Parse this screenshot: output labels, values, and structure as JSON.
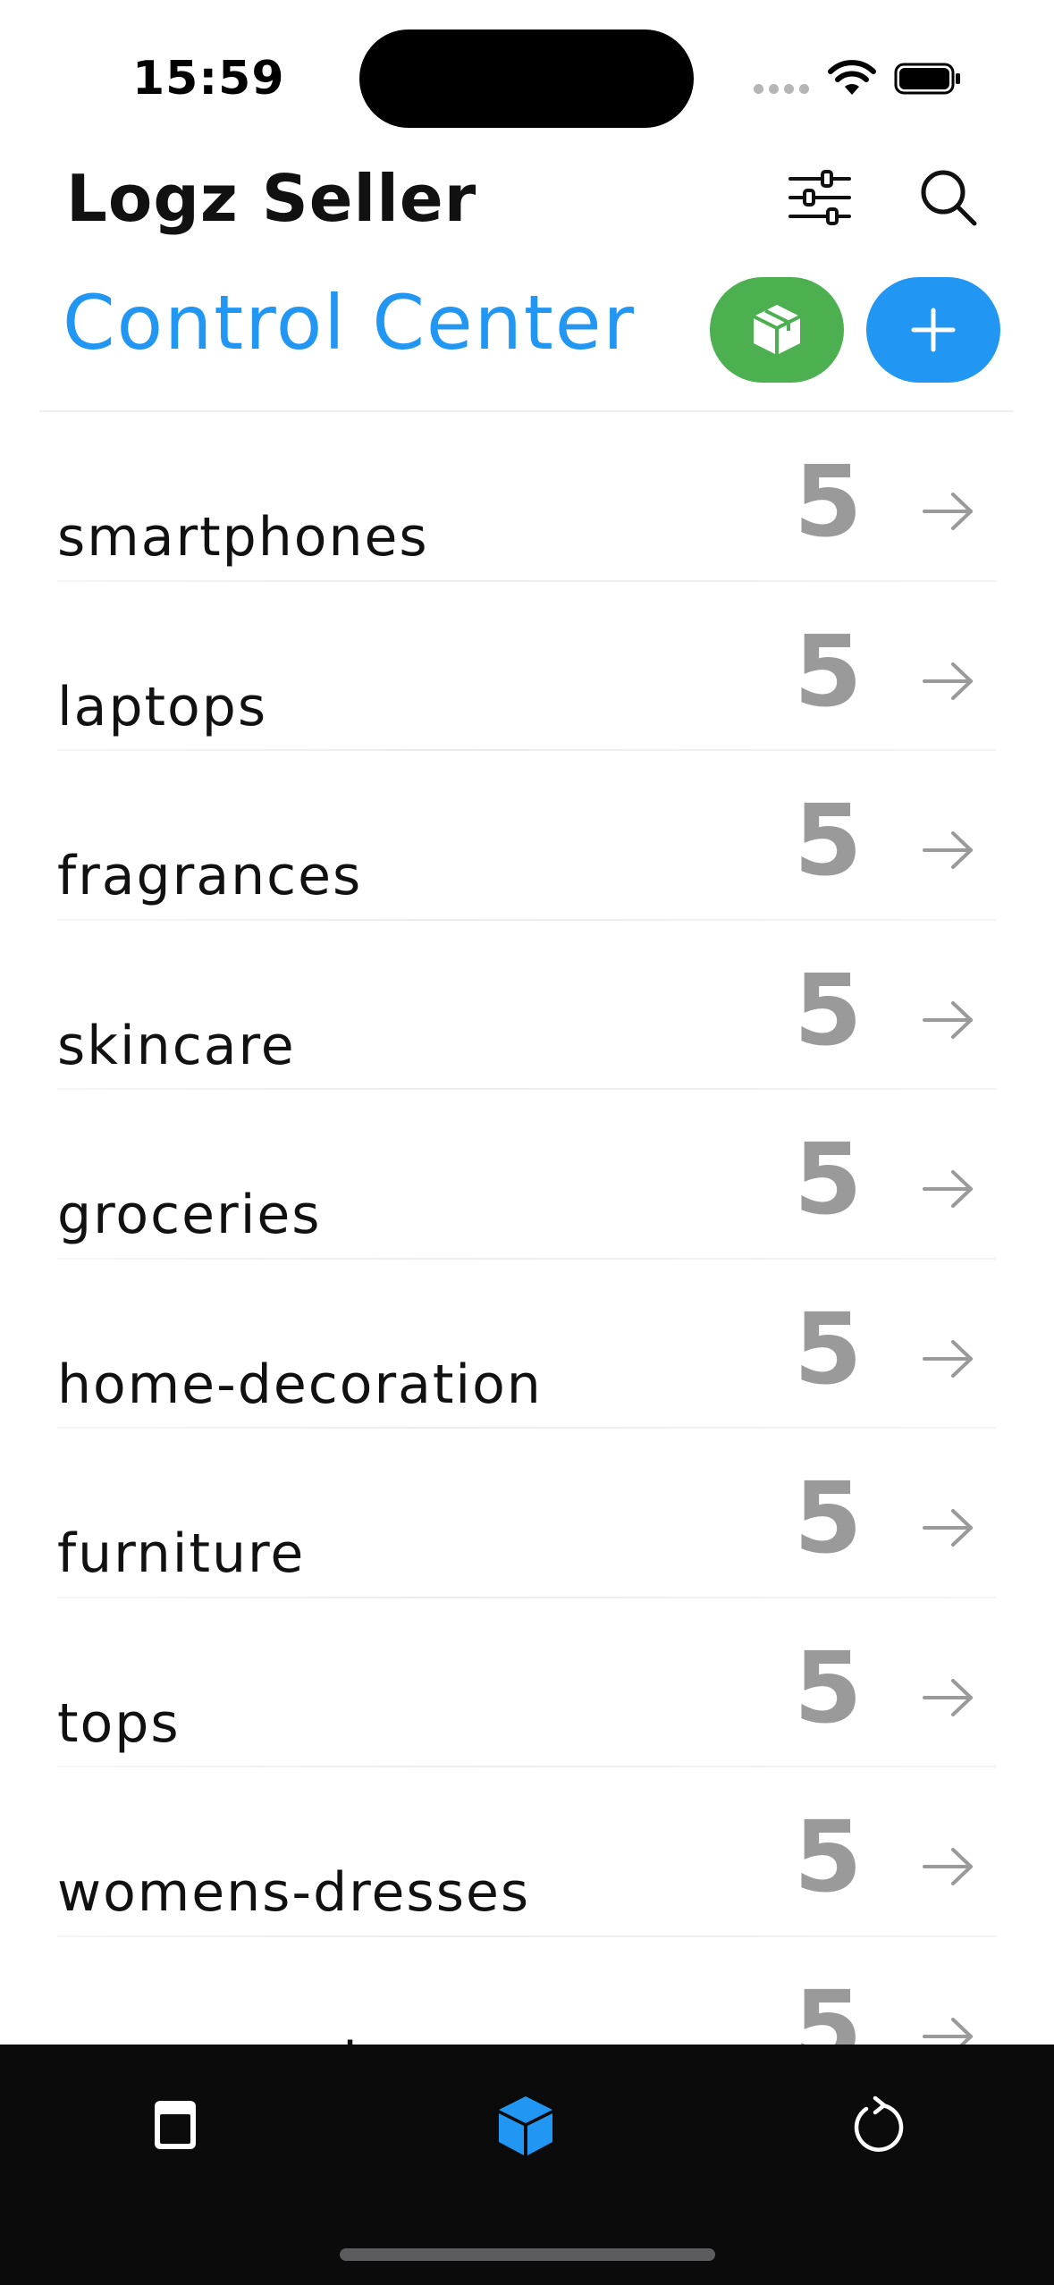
{
  "status_bar": {
    "time": "15:59"
  },
  "header": {
    "app_title": "Logz Seller",
    "filter_icon": "sliders-icon",
    "search_icon": "search-icon"
  },
  "section": {
    "title": "Control Center",
    "primary_action_icon": "package-icon",
    "add_action_icon": "plus-icon"
  },
  "categories": [
    {
      "name": "smartphones",
      "count": "5"
    },
    {
      "name": "laptops",
      "count": "5"
    },
    {
      "name": "fragrances",
      "count": "5"
    },
    {
      "name": "skincare",
      "count": "5"
    },
    {
      "name": "groceries",
      "count": "5"
    },
    {
      "name": "home-decoration",
      "count": "5"
    },
    {
      "name": "furniture",
      "count": "5"
    },
    {
      "name": "tops",
      "count": "5"
    },
    {
      "name": "womens-dresses",
      "count": "5"
    },
    {
      "name": "womens-shoes",
      "count": "5"
    }
  ],
  "tab_bar": {
    "tabs": [
      {
        "icon": "book-icon",
        "active": false
      },
      {
        "icon": "cube-icon",
        "active": true
      },
      {
        "icon": "refresh-icon",
        "active": false
      }
    ]
  },
  "colors": {
    "accent_blue": "#2196f3",
    "accent_green": "#4caf50",
    "count_gray": "#9a9a9a",
    "tabbar_bg": "#0b0b0c"
  }
}
